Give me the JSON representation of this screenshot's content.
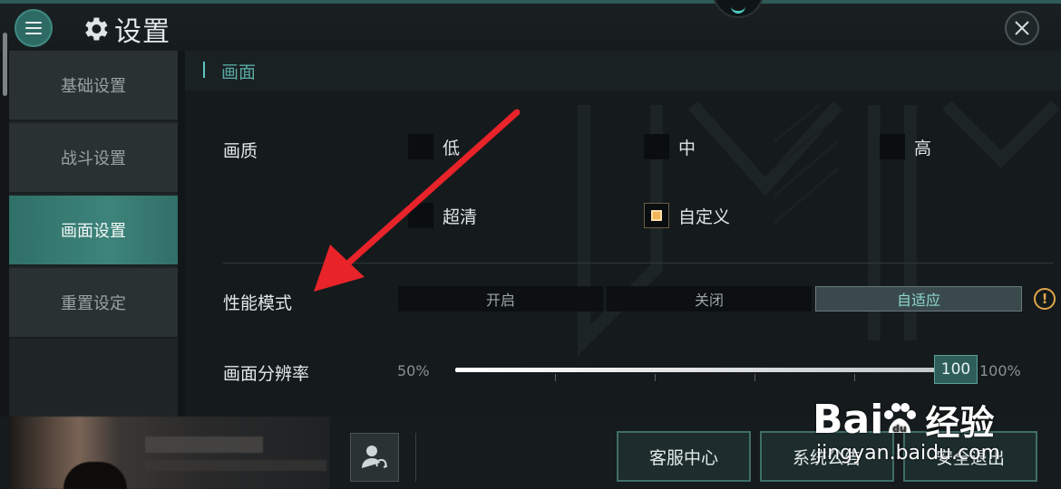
{
  "header": {
    "title": "设置",
    "menu_icon": "menu-icon",
    "settings_icon": "gear-icon",
    "close_icon": "close-icon"
  },
  "sidebar": {
    "items": [
      {
        "label": "基础设置",
        "active": false
      },
      {
        "label": "战斗设置",
        "active": false
      },
      {
        "label": "画面设置",
        "active": true
      },
      {
        "label": "重置设定",
        "active": false
      }
    ]
  },
  "section": {
    "title": "画面"
  },
  "quality": {
    "label": "画质",
    "options": [
      {
        "label": "低",
        "checked": false
      },
      {
        "label": "中",
        "checked": false
      },
      {
        "label": "高",
        "checked": false
      },
      {
        "label": "超清",
        "checked": false
      },
      {
        "label": "自定义",
        "checked": true
      }
    ]
  },
  "performance": {
    "label": "性能模式",
    "options": [
      "开启",
      "关闭",
      "自适应"
    ],
    "selected": "自适应",
    "warning_icon": "warning-icon",
    "warning_glyph": "!"
  },
  "resolution": {
    "label": "画面分辨率",
    "min_label": "50%",
    "max_label": "100%",
    "value": "100",
    "value_fraction": 1.0
  },
  "footer": {
    "swap_icon": "user-swap-icon",
    "buttons": [
      "客服中心",
      "系统公告",
      "安全退出"
    ]
  },
  "watermark": {
    "logo": "Bai",
    "logo2": "du",
    "cn": "经验",
    "url": "jingyan.baidu.com"
  },
  "colors": {
    "accent": "#3d847b",
    "highlight": "#f2b458",
    "warning": "#e0a648",
    "annotation_arrow": "#e8232a"
  }
}
